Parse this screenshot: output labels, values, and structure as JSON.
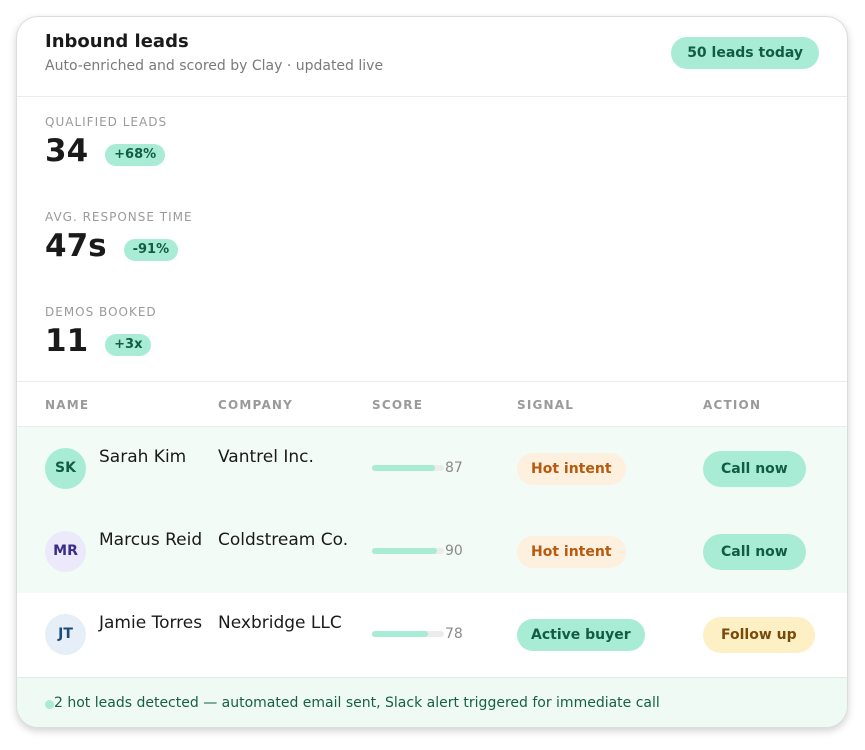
{
  "header": {
    "title": "Inbound leads",
    "subtitle": "Auto-enriched and scored by Clay · updated live",
    "badge": "50 leads today"
  },
  "metrics": [
    {
      "label": "QUALIFIED LEADS",
      "value": "34",
      "delta": "+68%"
    },
    {
      "label": "AVG. RESPONSE TIME",
      "value": "47s",
      "delta": "-91%"
    },
    {
      "label": "DEMOS BOOKED",
      "value": "11",
      "delta": "+3x"
    }
  ],
  "table": {
    "columns": [
      "NAME",
      "COMPANY",
      "SCORE",
      "SIGNAL",
      "ACTION"
    ],
    "rows": [
      {
        "initials": "SK",
        "name": "Sarah Kim",
        "company": "Vantrel Inc.",
        "score": 87,
        "score_label": "87",
        "signal": "Hot intent",
        "action": "Call now"
      },
      {
        "initials": "MR",
        "name": "Marcus Reid",
        "company": "Coldstream Co.",
        "score": 90,
        "score_label": "90",
        "signal": "Hot intent",
        "action": "Call now"
      },
      {
        "initials": "JT",
        "name": "Jamie Torres",
        "company": "Nexbridge LLC",
        "score": 78,
        "score_label": "78",
        "signal": "Active buyer",
        "action": "Follow up"
      }
    ]
  },
  "footer": {
    "message": "2 hot leads detected — automated email sent, Slack alert triggered for immediate call"
  },
  "colors": {
    "accent_mint": "#a8ecd5",
    "accent_dark_green": "#135c44",
    "hot_bg": "#fdf0df",
    "hot_text": "#b85a0e",
    "follow_bg": "#fdf0c4",
    "follow_text": "#7a4a0a",
    "row_highlight": "#f3fbf7"
  }
}
